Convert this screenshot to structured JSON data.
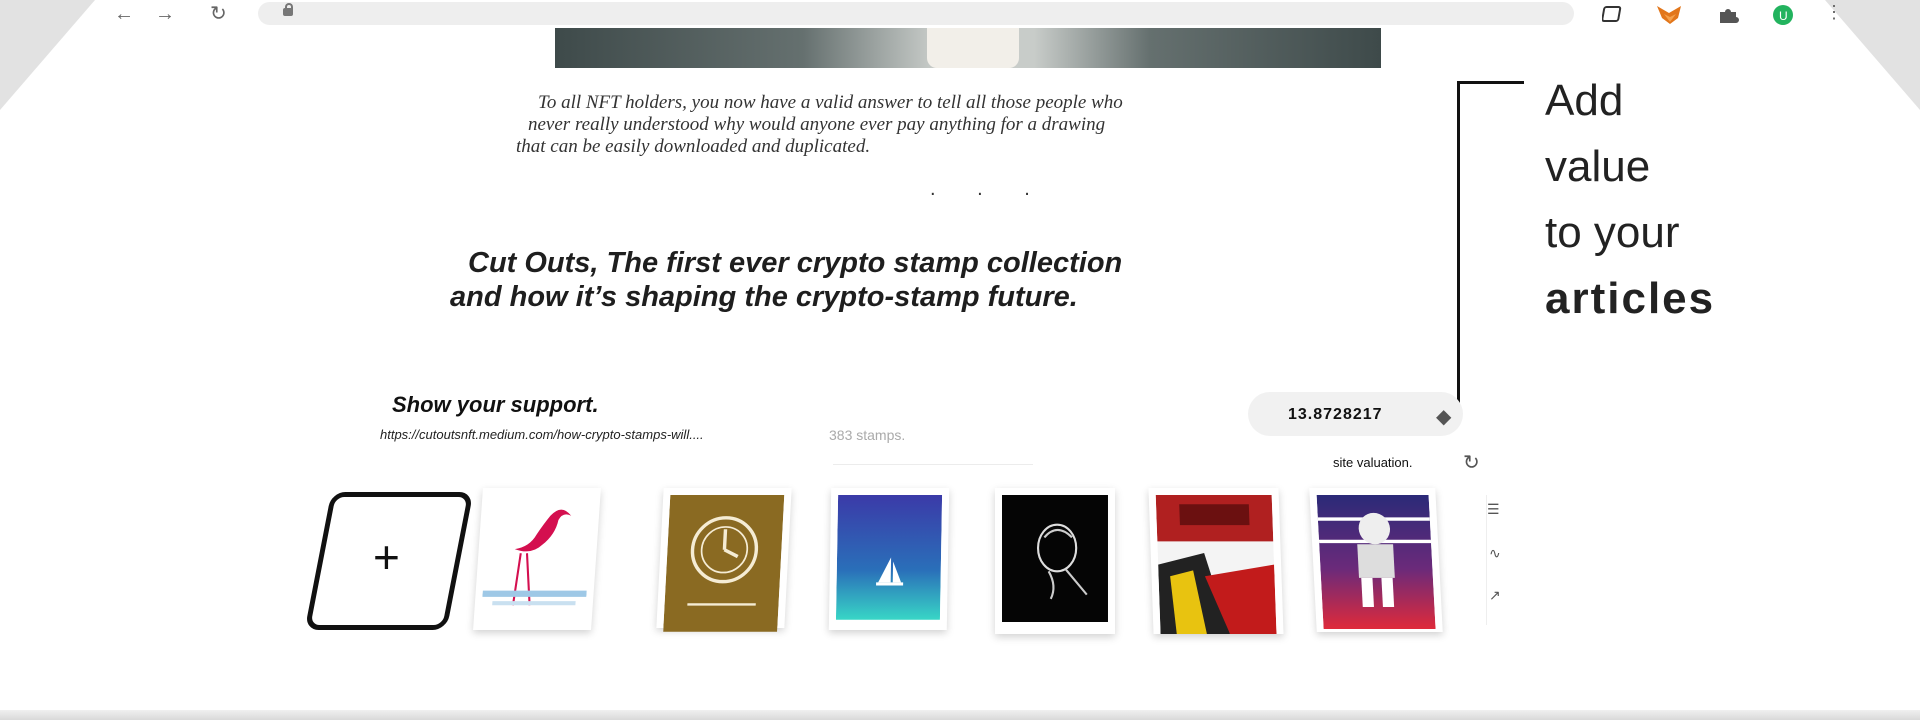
{
  "browser": {
    "back_icon": "back-arrow-icon",
    "forward_icon": "forward-arrow-icon",
    "reload_icon": "reload-icon",
    "lock_icon": "lock-icon"
  },
  "article": {
    "body": [
      "To all NFT holders, you now have a valid answer to tell all those people who",
      "never really understood why would anyone ever pay anything for a drawing",
      "that can be easily downloaded and duplicated."
    ],
    "separator": ". . .",
    "headline": [
      "Cut Outs, The first ever crypto stamp collection",
      "and how it’s shaping the crypto-stamp future."
    ]
  },
  "annotation": {
    "lines": [
      "Add",
      "value",
      "to your"
    ],
    "bold": "articles"
  },
  "support": {
    "title": "Show your support.",
    "url": "https://cutoutsnft.medium.com/how-crypto-stamps-will....",
    "stamps": "383 stamps.",
    "valuation": "13.8728217",
    "valuation_label": "site valuation.",
    "add_label": "+"
  },
  "colors": {
    "hero_dark": "#3e4a4a",
    "annotation_text": "#222222",
    "pill_bg": "#f1f1f1"
  }
}
